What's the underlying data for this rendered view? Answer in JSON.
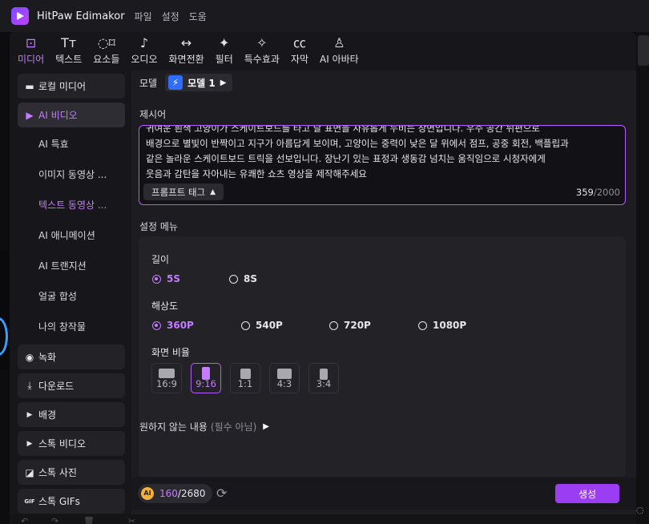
{
  "app": {
    "title": "HitPaw Edimakor",
    "menu": [
      "파일",
      "설정",
      "도움"
    ]
  },
  "toolbar": {
    "tools": [
      {
        "label": "미디어",
        "icon": "media-icon",
        "glyph": "⊡"
      },
      {
        "label": "텍스트",
        "icon": "text-icon",
        "glyph": "Tт"
      },
      {
        "label": "요소들",
        "icon": "elements-icon",
        "glyph": "◌⌑"
      },
      {
        "label": "오디오",
        "icon": "audio-icon",
        "glyph": "♪"
      },
      {
        "label": "화면전환",
        "icon": "transition-icon",
        "glyph": "↔"
      },
      {
        "label": "필터",
        "icon": "filter-icon",
        "glyph": "✦"
      },
      {
        "label": "특수효과",
        "icon": "effects-icon",
        "glyph": "✧"
      },
      {
        "label": "자막",
        "icon": "caption-icon",
        "glyph": "㏄"
      },
      {
        "label": "AI 아바타",
        "icon": "avatar-icon",
        "glyph": "♙"
      }
    ]
  },
  "sidebar": {
    "local_media": {
      "label": "로컬 미디어",
      "glyph": "▬"
    },
    "ai_video": {
      "label": "AI 비디오",
      "glyph": "▶"
    },
    "sub_items": [
      "AI 특효",
      "이미지 동영상 ...",
      "텍스트 동영상 ...",
      "AI 애니메이션",
      "AI 트랜지션",
      "얼굴 합성",
      "나의 창작물"
    ],
    "record": {
      "label": "녹화",
      "glyph": "◉"
    },
    "download": {
      "label": "다운로드",
      "glyph": "⤓"
    },
    "background": {
      "label": "배경",
      "glyph": "▶"
    },
    "stock_video": {
      "label": "스톡 비디오",
      "glyph": "▶"
    },
    "stock_photo": {
      "label": "스톡 사진",
      "glyph": "◪"
    },
    "stock_gifs": {
      "label": "스톡 GIFs",
      "glyph": "GIF"
    }
  },
  "main": {
    "model_label": "모델",
    "model_name": "모델 1",
    "prompt_section": "제시어",
    "prompt_lines": [
      "귀여운 흰색 고양이가 스케이트보드를 타고 달 표면을 자유롭게 누비는 장면입니다. 우주 공간 뒤편으로",
      "배경으로 별빛이 반짝이고 지구가 아름답게 보이며, 고양이는 중력이 낮은 달 위에서 점프, 공중 회전, 백플립과",
      "같은 놀라운 스케이트보드 트릭을 선보입니다. 장난기 있는 표정과 생동감 넘치는 움직임으로 시청자에게",
      "웃음과 감탄을 자아내는 유쾌한 쇼츠 영상을 제작해주세요"
    ],
    "prompt_tag": "프롬프트 태그",
    "prompt_count": "359",
    "prompt_max": "/2000",
    "settings_title": "설정 메뉴",
    "length_label": "길이",
    "length_options": [
      "5S",
      "8S"
    ],
    "resolution_label": "해상도",
    "resolution_options": [
      "360P",
      "540P",
      "720P",
      "1080P"
    ],
    "ratio_label": "화면 비율",
    "ratio_options": [
      "16:9",
      "9:16",
      "1:1",
      "4:3",
      "3:4"
    ],
    "negative_label": "원하지 않는 내용",
    "negative_optional": "(필수 아님)",
    "credits_used": "160",
    "credits_total": "/2680",
    "generate_label": "생성"
  },
  "colors": {
    "accent": "#c57cff",
    "generate": "#9b3df2",
    "background": "#1c1c21"
  }
}
